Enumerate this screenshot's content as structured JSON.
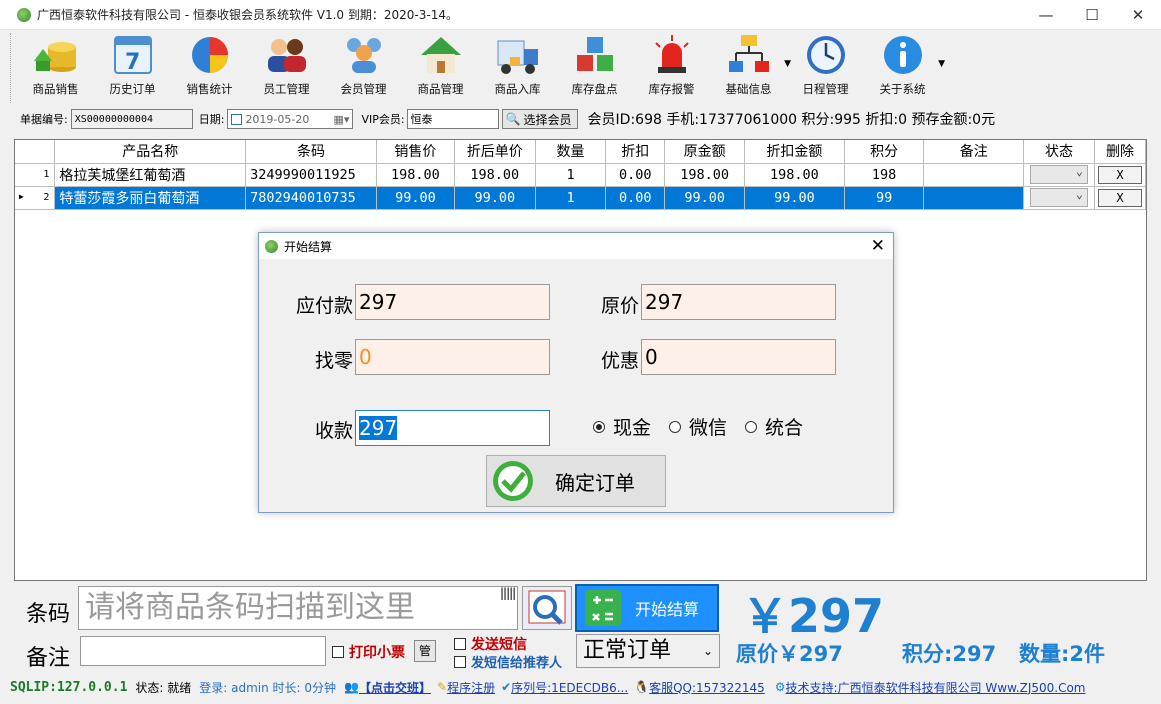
{
  "window": {
    "title": "广西恒泰软件科技有限公司 - 恒泰收银会员系统软件 V1.0    到期：2020-3-14。",
    "minimize": "—",
    "maximize": "☐",
    "close": "✕"
  },
  "toolbar": [
    {
      "label": "商品销售",
      "icon": "coins-icon"
    },
    {
      "label": "历史订单",
      "icon": "calendar-icon"
    },
    {
      "label": "销售统计",
      "icon": "pie-chart-icon"
    },
    {
      "label": "员工管理",
      "icon": "staff-icon"
    },
    {
      "label": "会员管理",
      "icon": "members-icon"
    },
    {
      "label": "商品管理",
      "icon": "house-icon"
    },
    {
      "label": "商品入库",
      "icon": "truck-icon"
    },
    {
      "label": "库存盘点",
      "icon": "cubes-icon"
    },
    {
      "label": "库存报警",
      "icon": "alarm-icon"
    },
    {
      "label": "基础信息",
      "icon": "org-chart-icon"
    },
    {
      "label": "日程管理",
      "icon": "clock-icon"
    },
    {
      "label": "关于系统",
      "icon": "info-icon"
    }
  ],
  "form": {
    "order_no_label": "单据编号:",
    "order_no": "XS00000000004",
    "date_label": "日期:",
    "date": "2019-05-20",
    "vip_label": "VIP会员:",
    "vip": "恒泰",
    "select_member": "选择会员",
    "member_info": "会员ID:698 手机:17377061000 积分:995 折扣:0 预存金额:0元"
  },
  "table": {
    "headers": [
      "产品名称",
      "条码",
      "销售价",
      "折后单价",
      "数量",
      "折扣",
      "原金额",
      "折扣金额",
      "积分",
      "备注",
      "状态",
      "删除"
    ],
    "rows": [
      {
        "idx": "1",
        "name": "格拉芙城堡红葡萄酒",
        "code": "3249990011925",
        "price": "198.00",
        "disc_price": "198.00",
        "qty": "1",
        "discount": "0.00",
        "orig": "198.00",
        "disc_amt": "198.00",
        "points": "198",
        "note": "",
        "del": "X"
      },
      {
        "idx": "2",
        "name": "特蕾莎霞多丽白葡萄酒",
        "code": "7802940010735",
        "price": "99.00",
        "disc_price": "99.00",
        "qty": "1",
        "discount": "0.00",
        "orig": "99.00",
        "disc_amt": "99.00",
        "points": "99",
        "note": "",
        "del": "X"
      }
    ]
  },
  "dialog": {
    "title": "开始结算",
    "payable_label": "应付款",
    "payable": "297",
    "original_label": "原价",
    "original": "297",
    "change_label": "找零",
    "change": "0",
    "discount_label": "优惠",
    "discount": "0",
    "received_label": "收款",
    "received": "297",
    "pay_methods": [
      "现金",
      "微信",
      "统合"
    ],
    "selected_method": "现金",
    "confirm": "确定订单"
  },
  "bottom": {
    "barcode_label": "条码",
    "barcode_placeholder": "请将商品条码扫描到这里",
    "checkout": "开始结算",
    "total": "￥297",
    "note_label": "备注",
    "print_receipt": "打印小票",
    "manage": "管",
    "send_sms": "发送短信",
    "sms_referrer": "发短信给推荐人",
    "order_type": "正常订单",
    "original_price": "原价￥297",
    "points": "积分:297",
    "quantity": "数量:2件"
  },
  "status": {
    "sqlip": "SQLIP:127.0.0.1",
    "state": "状态: 就绪",
    "login": "登录: admin 时长: 0分钟",
    "exchange": "【点击交班】",
    "register": "程序注册",
    "serial": "序列号:1EDECDB6...",
    "qq": "客服QQ:157322145",
    "support": "技术支持:广西恒泰软件科技有限公司 Www.ZJ500.Com"
  },
  "colors": {
    "selection": "#0078d7",
    "accent_blue": "#1f7fd0",
    "checkout_btn": "#1e90ff",
    "red": "#c00000",
    "field_bg": "#fdf0e8"
  }
}
